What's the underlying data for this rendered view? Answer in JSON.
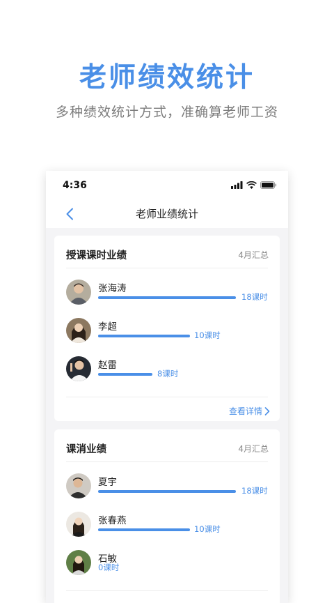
{
  "hero": {
    "title": "老师绩效统计",
    "subtitle": "多种绩效统计方式，准确算老师工资"
  },
  "status_bar": {
    "time": "4:36"
  },
  "nav": {
    "title": "老师业绩统计"
  },
  "teaching_card": {
    "title": "授课课时业绩",
    "period": "4月汇总",
    "link": "查看详情",
    "rows": [
      {
        "name": "张海涛",
        "hours": "18课时",
        "value": 18
      },
      {
        "name": "李超",
        "hours": "10课时",
        "value": 10
      },
      {
        "name": "赵雷",
        "hours": "8课时",
        "value": 8
      }
    ]
  },
  "consume_card": {
    "title": "课消业绩",
    "period": "4月汇总",
    "rows": [
      {
        "name": "夏宇",
        "hours": "18课时",
        "value": 18
      },
      {
        "name": "张春燕",
        "hours": "10课时",
        "value": 10
      },
      {
        "name": "石敏",
        "hours": "0课时",
        "value": 0
      }
    ]
  },
  "colors": {
    "accent": "#4a8fe7",
    "background": "#f4f4f6"
  },
  "icons": [
    "signal-icon",
    "wifi-icon",
    "battery-icon",
    "back-chevron-icon",
    "chevron-right-icon"
  ]
}
